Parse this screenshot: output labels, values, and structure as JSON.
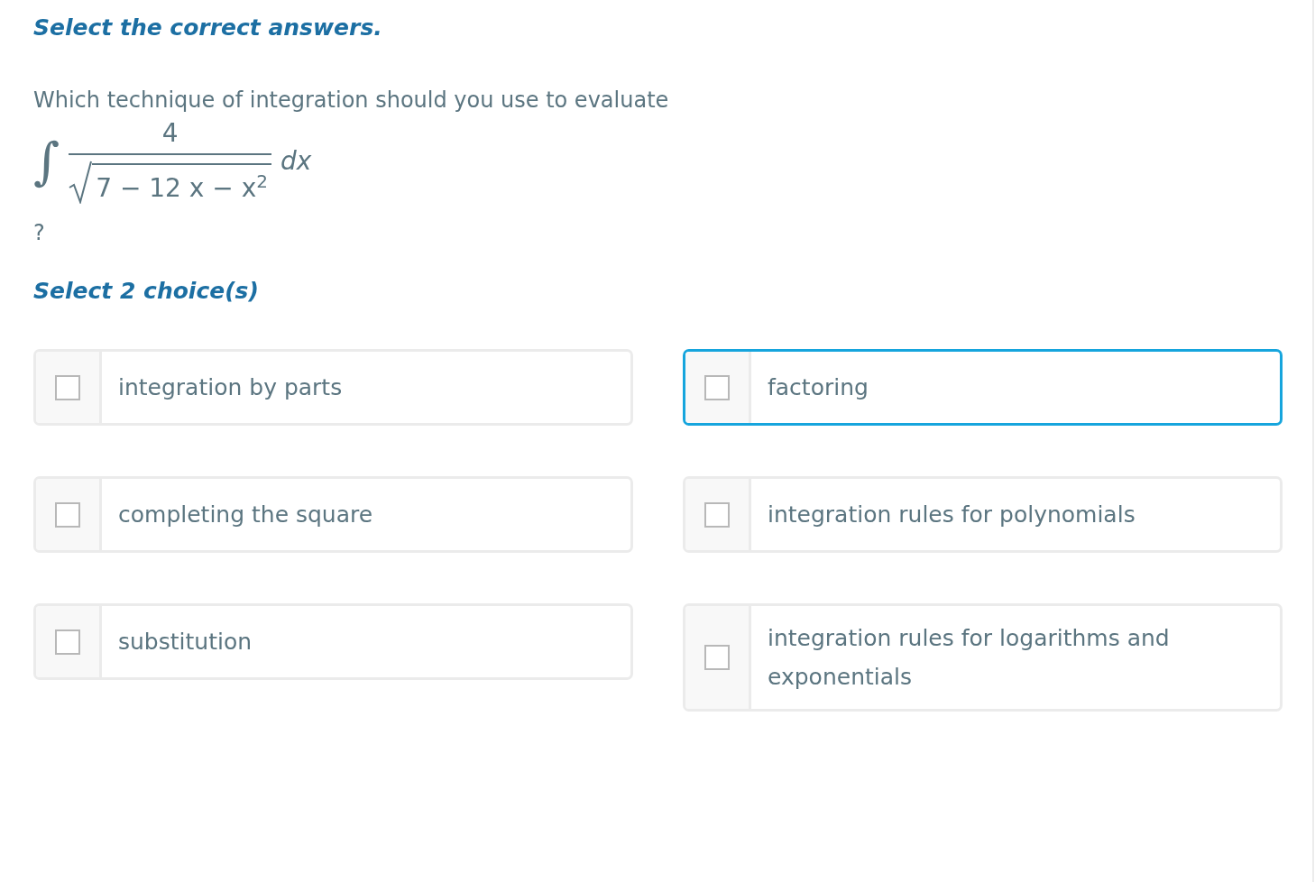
{
  "instruction": "Select the correct answers.",
  "question": {
    "text": "Which technique of integration should you use to evaluate",
    "formula": {
      "integral": "∫",
      "numerator": "4",
      "radicand": "7 − 12 x − x$^{2}$",
      "differential": "dx"
    },
    "end": "?"
  },
  "choice_prompt": "Select 2 choice(s)",
  "choices": [
    {
      "label": "integration by parts",
      "checked": false,
      "focused": false
    },
    {
      "label": "factoring",
      "checked": false,
      "focused": true
    },
    {
      "label": "completing the square",
      "checked": false,
      "focused": false
    },
    {
      "label": "integration rules for polynomials",
      "checked": false,
      "focused": false
    },
    {
      "label": "substitution",
      "checked": false,
      "focused": false
    },
    {
      "label": "integration rules for logarithms and exponentials",
      "checked": false,
      "focused": false
    }
  ]
}
